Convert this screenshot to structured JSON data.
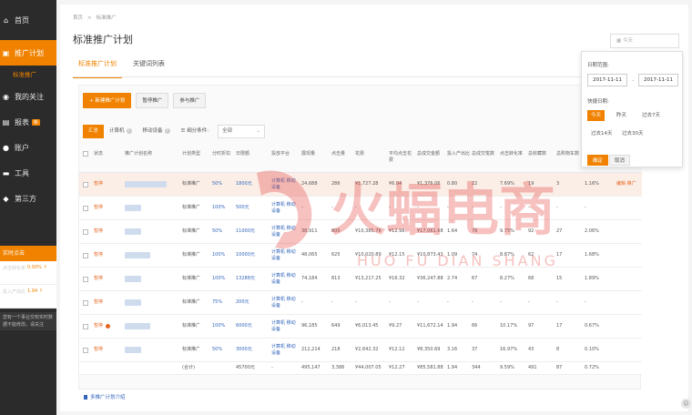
{
  "sidebar": {
    "items": [
      {
        "label": "首页",
        "icon": "home-icon"
      },
      {
        "label": "推广计划",
        "icon": "megaphone-icon"
      },
      {
        "label": "我的关注",
        "icon": "eye-icon"
      },
      {
        "label": "报表",
        "icon": "chart-icon",
        "badge": "新"
      },
      {
        "label": "账户",
        "icon": "user-icon"
      },
      {
        "label": "工具",
        "icon": "toolbox-icon"
      },
      {
        "label": "第三方",
        "icon": "plugin-icon"
      }
    ],
    "sub_item": "标准推广",
    "realtime": {
      "title": "实时点击",
      "rows": [
        {
          "label": "点击转化率",
          "value": "0.00% ↑"
        },
        {
          "label": "投入产出比",
          "value": "1.94 ↑"
        }
      ],
      "note": "您有一个事业交权实时数据不能修改，请关注"
    }
  },
  "breadcrumb": {
    "root": "首页",
    "sep": ">",
    "current": "标准推广"
  },
  "page_title": "标准推广计划",
  "tabs": [
    {
      "label": "标准推广计划"
    },
    {
      "label": "关键词列表"
    }
  ],
  "toolbar": {
    "new_label": "+ 新建推广计划",
    "pause_label": "暂停推广",
    "resume_label": "参与推广"
  },
  "filters": {
    "segments": [
      "汇总",
      "计算机",
      "移动设备"
    ],
    "field_label": "细分条件:",
    "select_value": "全部"
  },
  "date_picker": {
    "input_placeholder": "今天",
    "range_label": "日期范围:",
    "start": "2017-11-11",
    "sep": "-",
    "end": "2017-11-11",
    "quick_label": "快捷日期:",
    "quick": [
      "今天",
      "昨天",
      "过去7天",
      "过去14天",
      "过去30天"
    ],
    "confirm": "确定",
    "cancel": "取消"
  },
  "table": {
    "headers": [
      "状态",
      "推广计划名称",
      "计划类型",
      "分时折扣",
      "日限额",
      "投放平台",
      "展现量",
      "点击量",
      "花费",
      "平均点击花费",
      "总成交金额",
      "投入产出比",
      "总成交笔数",
      "点击转化率",
      "总收藏数",
      "总购物车数",
      "直接转化率",
      "操作"
    ],
    "rows": [
      {
        "status": "暂停",
        "type": "标准推广",
        "discount": "50%",
        "budget": "1800元",
        "platform": "计算机 移动设备",
        "impressions": "24,688",
        "clicks": "286",
        "cost": "¥1,727.28",
        "cpc": "¥6.04",
        "gmv": "¥1,376.06",
        "roi": "0.80",
        "orders": "22",
        "cvr": "7.69%",
        "fav": "19",
        "cart": "3",
        "direct": "1.16%",
        "ops": "编辑 推广",
        "hl": true
      },
      {
        "status": "暂停",
        "type": "标准推广",
        "discount": "100%",
        "budget": "500元",
        "platform": "计算机 移动设备",
        "impressions": "-",
        "clicks": "-",
        "cost": "-",
        "cpc": "-",
        "gmv": "-",
        "roi": "-",
        "orders": "-",
        "cvr": "-",
        "fav": "-",
        "cart": "-",
        "direct": "-",
        "ops": ""
      },
      {
        "status": "暂停",
        "type": "标准推广",
        "discount": "50%",
        "budget": "11000元",
        "platform": "计算机 移动设备",
        "impressions": "38,911",
        "clicks": "800",
        "cost": "¥10,385.76",
        "cpc": "¥12.98",
        "gmv": "¥17,061.68",
        "roi": "1.64",
        "orders": "78",
        "cvr": "9.75%",
        "fav": "92",
        "cart": "27",
        "direct": "2.06%",
        "ops": ""
      },
      {
        "status": "暂停",
        "type": "标准推广",
        "discount": "100%",
        "budget": "10000元",
        "platform": "计算机 移动设备",
        "impressions": "48,065",
        "clicks": "625",
        "cost": "¥10,020.89",
        "cpc": "¥12.15",
        "gmv": "¥10,873.43",
        "roi": "1.09",
        "orders": "74",
        "cvr": "8.87%",
        "fav": "62",
        "cart": "17",
        "direct": "1.68%",
        "ops": ""
      },
      {
        "status": "暂停",
        "type": "标准推广",
        "discount": "100%",
        "budget": "13288元",
        "platform": "计算机 移动设备",
        "impressions": "74,184",
        "clicks": "813",
        "cost": "¥13,217.25",
        "cpc": "¥16.32",
        "gmv": "¥36,247.88",
        "roi": "2.74",
        "orders": "67",
        "cvr": "8.27%",
        "fav": "68",
        "cart": "15",
        "direct": "1.89%",
        "ops": ""
      },
      {
        "status": "暂停",
        "type": "标准推广",
        "discount": "75%",
        "budget": "200元",
        "platform": "计算机 移动设备",
        "impressions": "-",
        "clicks": "-",
        "cost": "-",
        "cpc": "-",
        "gmv": "-",
        "roi": "-",
        "orders": "-",
        "cvr": "-",
        "fav": "-",
        "cart": "-",
        "direct": "-",
        "ops": ""
      },
      {
        "status": "暂停",
        "type": "标准推广",
        "discount": "100%",
        "budget": "6000元",
        "platform": "计算机 移动设备",
        "impressions": "96,185",
        "clicks": "649",
        "cost": "¥6,013.45",
        "cpc": "¥9.27",
        "gmv": "¥11,672.14",
        "roi": "1.94",
        "orders": "66",
        "cvr": "10.17%",
        "fav": "97",
        "cart": "17",
        "direct": "0.67%",
        "ops": "",
        "warn": true
      },
      {
        "status": "暂停",
        "type": "标准推广",
        "discount": "50%",
        "budget": "3000元",
        "platform": "计算机 移动设备",
        "impressions": "212,214",
        "clicks": "218",
        "cost": "¥2,642.32",
        "cpc": "¥12.12",
        "gmv": "¥8,350.69",
        "roi": "3.16",
        "orders": "37",
        "cvr": "16.97%",
        "fav": "43",
        "cart": "8",
        "direct": "0.10%",
        "ops": ""
      }
    ],
    "total": {
      "label": "(合计)",
      "budget": "45700元",
      "platform": "-",
      "impressions": "495,147",
      "clicks": "3,386",
      "cost": "¥44,007.05",
      "cpc": "¥12.27",
      "gmv": "¥85,581.88",
      "roi": "1.94",
      "orders": "344",
      "cvr": "9.59%",
      "fav": "491",
      "cart": "87",
      "direct": "0.72%"
    }
  },
  "more_link": "多推广计划介绍",
  "watermark": {
    "line1": "火蝠电商",
    "line2": "HUO FU DIAN SHANG"
  },
  "colors": {
    "accent": "#f08200",
    "sidebar_bg": "#2b2b2b",
    "status_red": "#e5641e",
    "link_blue": "#3366bb",
    "watermark": "#e4413c"
  }
}
